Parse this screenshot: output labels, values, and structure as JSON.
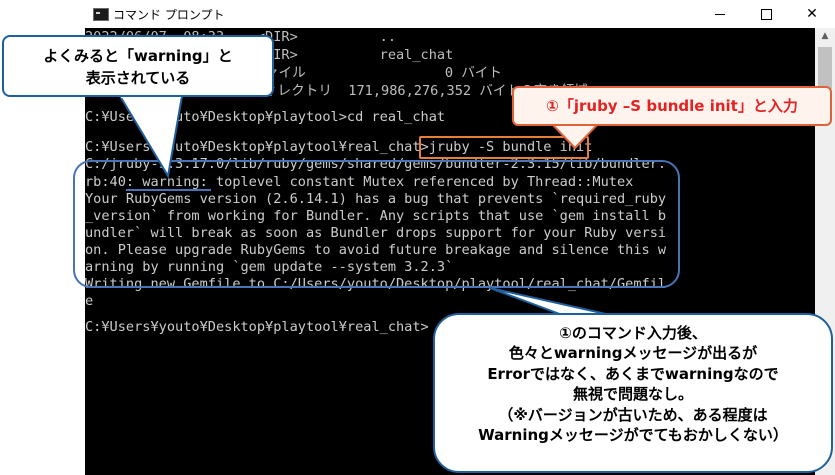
{
  "window": {
    "title": "コマンド プロンプト",
    "controls": {
      "minimize": "",
      "maximize": "",
      "close": "✕"
    },
    "icon": "console-app-icon"
  },
  "console": {
    "lines": [
      "2022/06/07  08:33    <DIR>          ..",
      "2022/06/07  08:33    <DIR>          real_chat",
      "               1 個のファイル                 0 バイト",
      "               4 個のディレクトリ  171,986,276,352 バイトの空き領域",
      "",
      "C:¥Users¥youto¥Desktop¥playtool>cd real_chat",
      "",
      "C:¥Users¥youto¥Desktop¥playtool¥real_chat>jruby -S bundle init",
      "C:/jruby-9.3.17.0/lib/ruby/gems/shared/gems/bundler-2.3.15/lib/bundler.",
      "rb:40: warning: toplevel constant Mutex referenced by Thread::Mutex",
      "Your RubyGems version (2.6.14.1) has a bug that prevents `required_ruby",
      "_version` from working for Bundler. Any scripts that use `gem install b",
      "undler` will break as soon as Bundler drops support for your Ruby versi",
      "on. Please upgrade RubyGems to avoid future breakage and silence this w",
      "arning by running `gem update --system 3.2.3`",
      "Writing new Gemfile to C:/Users/youto/Desktop/playtool/real_chat/Gemfil",
      "e",
      "",
      "C:¥Users¥youto¥Desktop¥playtool¥real_chat>"
    ]
  },
  "annotations": {
    "warning_callout": {
      "line1": "よくみると「warning」と",
      "line2": "表示されている"
    },
    "command_callout": "①「jruby –S bundle init」と入力",
    "explanation_callout": [
      "①のコマンド入力後、",
      "色々とwarningメッセージが出るが",
      "Errorではなく、あくまでwarningなので",
      "無視で問題なし。",
      "（※バージョンが古いため、ある程度は",
      "Warningメッセージがでてもおかしくない）"
    ]
  },
  "colors": {
    "console_bg": "#000000",
    "console_text": "#cccccc",
    "callout_blue": "#1f5f9b",
    "callout_orange": "#e0623a",
    "callout_red_text": "#e32222"
  }
}
